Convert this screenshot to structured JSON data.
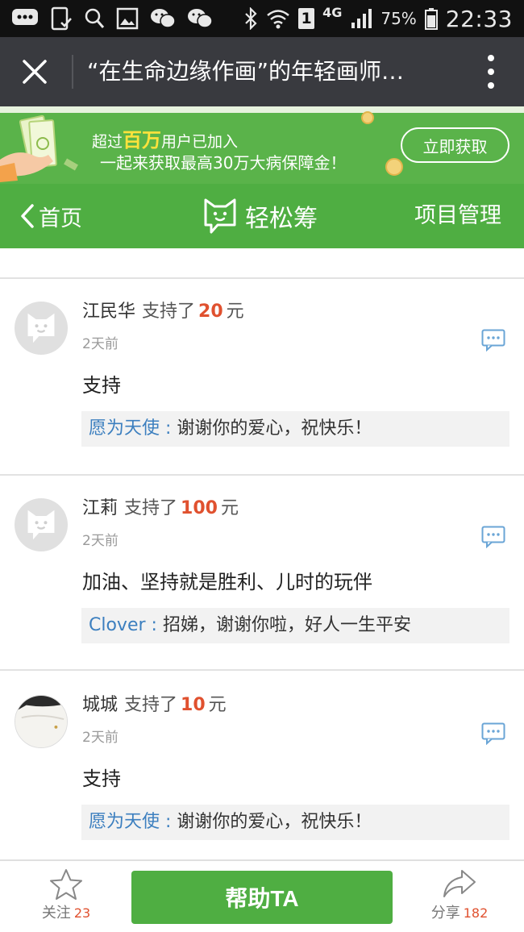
{
  "status_bar": {
    "time": "22:33",
    "battery": "75%",
    "network": "4G",
    "sim": "1",
    "left_icons": [
      "message-icon",
      "phone-check-icon",
      "search-icon",
      "image-icon",
      "wechat-icon",
      "wechat-icon"
    ],
    "right_icons": [
      "bluetooth-icon",
      "wifi-icon",
      "signal-icon",
      "battery-icon"
    ]
  },
  "title_bar": {
    "title": "“在生命边缘作画”的年轻画师…"
  },
  "banner": {
    "line1_prefix": "超过",
    "line1_highlight": "百万",
    "line1_suffix": "用户已加入",
    "line2": "一起来获取最高30万大病保障金！",
    "button": "立即获取"
  },
  "nav": {
    "back_label": "首页",
    "logo_text": "轻松筹",
    "manage_label": "项目管理"
  },
  "comments": [
    {
      "name": "江民华",
      "support_text": "支持了",
      "amount": "20",
      "unit": "元",
      "time": "2天前",
      "text": "支持",
      "reply_name": "愿为天使",
      "reply_text": "谢谢你的爱心，祝快乐！",
      "avatar": "default"
    },
    {
      "name": "江莉",
      "support_text": "支持了",
      "amount": "100",
      "unit": "元",
      "time": "2天前",
      "text": "加油、坚持就是胜利、儿时的玩伴",
      "reply_name": "Clover",
      "reply_text": "招娣，谢谢你啦，好人一生平安",
      "avatar": "default"
    },
    {
      "name": "城城",
      "support_text": "支持了",
      "amount": "10",
      "unit": "元",
      "time": "2天前",
      "text": "支持",
      "reply_name": "愿为天使",
      "reply_text": "谢谢你的爱心，祝快乐！",
      "avatar": "photo"
    }
  ],
  "bottom_bar": {
    "follow_label": "关注",
    "follow_count": "23",
    "help_button": "帮助TA",
    "share_label": "分享",
    "share_count": "182"
  },
  "colors": {
    "brand_green": "#4fae42",
    "amount_red": "#e0512f",
    "reply_name_blue": "#3c7fbf",
    "title_bar": "#393a3f"
  }
}
